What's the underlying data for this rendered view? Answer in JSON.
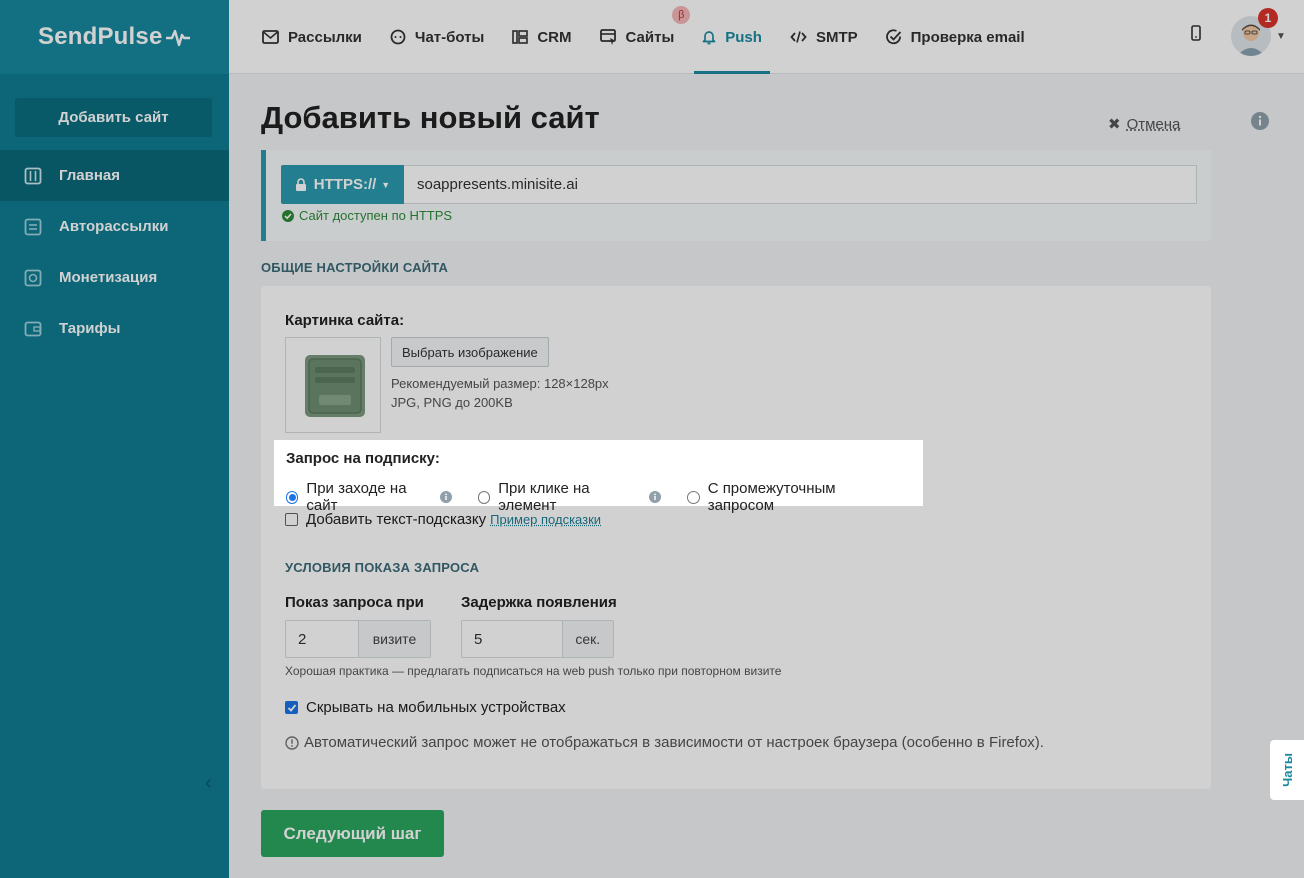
{
  "app": {
    "logo": "SendPulse"
  },
  "sidebar": {
    "add_site": "Добавить сайт",
    "items": [
      {
        "label": "Главная",
        "icon": "sliders-icon"
      },
      {
        "label": "Авторассылки",
        "icon": "flow-icon"
      },
      {
        "label": "Монетизация",
        "icon": "coin-icon"
      },
      {
        "label": "Тарифы",
        "icon": "wallet-icon"
      }
    ]
  },
  "topnav": {
    "tabs": [
      {
        "label": "Рассылки",
        "icon": "mail-icon"
      },
      {
        "label": "Чат-боты",
        "icon": "chat-icon"
      },
      {
        "label": "CRM",
        "icon": "crm-icon"
      },
      {
        "label": "Сайты",
        "icon": "site-icon",
        "beta": "β"
      },
      {
        "label": "Push",
        "icon": "bell-icon",
        "active": true
      },
      {
        "label": "SMTP",
        "icon": "code-icon"
      },
      {
        "label": "Проверка email",
        "icon": "check-circle-icon"
      }
    ],
    "notifications": "1"
  },
  "page": {
    "title": "Добавить новый сайт",
    "cancel": "Отмена"
  },
  "url": {
    "protocol": "HTTPS://",
    "value": "soappresents.minisite.ai",
    "status": "Сайт доступен по HTTPS"
  },
  "settings": {
    "section_title": "ОБЩИЕ НАСТРОЙКИ САЙТА",
    "image_label": "Картинка сайта:",
    "choose_image": "Выбрать изображение",
    "recommended_size": "Рекомендуемый размер: 128×128px",
    "formats": "JPG, PNG до 200KB",
    "subscription_label": "Запрос на подписку:",
    "subscription_options": [
      {
        "label": "При заходе на сайт",
        "checked": true,
        "info": true
      },
      {
        "label": "При клике на элемент",
        "checked": false,
        "info": true
      },
      {
        "label": "С промежуточным запросом",
        "checked": false,
        "info": false
      }
    ],
    "add_hint": "Добавить текст-подсказку",
    "hint_example": "Пример подсказки",
    "conditions_title": "УСЛОВИЯ ПОКАЗА ЗАПРОСА",
    "show_at_label": "Показ запроса при",
    "show_at_value": "2",
    "show_at_unit": "визите",
    "delay_label": "Задержка появления",
    "delay_value": "5",
    "delay_unit": "сек.",
    "practice_hint": "Хорошая практика — предлагать подписаться на web push только при повторном визите",
    "hide_mobile": "Скрывать на мобильных устройствах",
    "hide_mobile_checked": true,
    "auto_warning": "Автоматический запрос может не отображаться в зависимости от настроек браузера (особенно в Firefox)."
  },
  "next_step": "Следующий шаг",
  "chats": "Чаты"
}
